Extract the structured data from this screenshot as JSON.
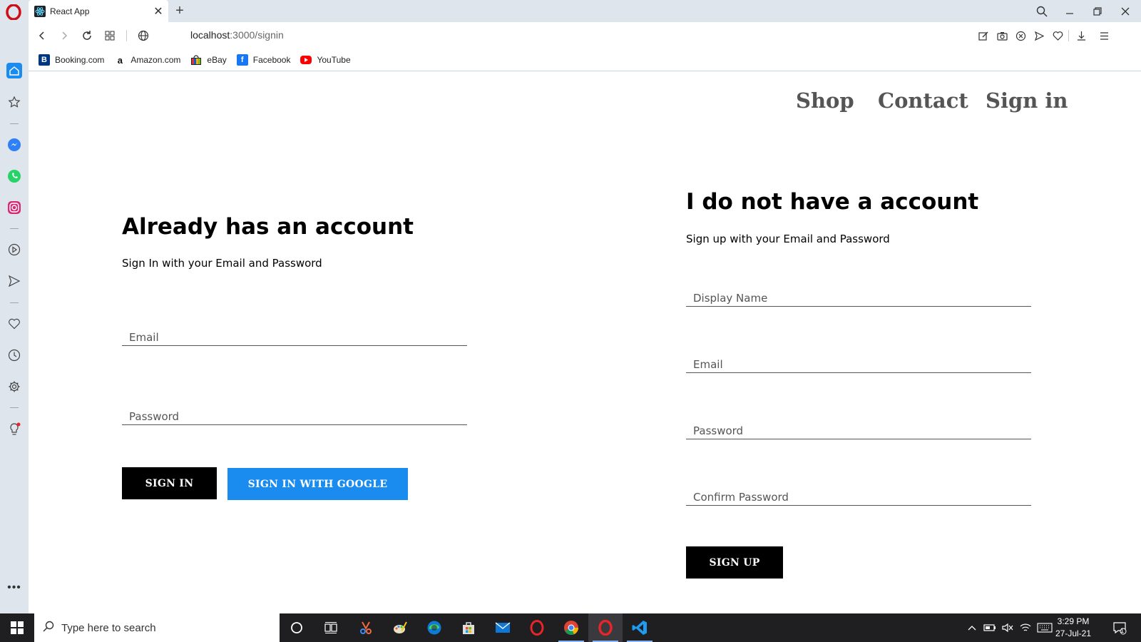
{
  "browser": {
    "tab_title": "React App",
    "url_host": "localhost",
    "url_path": ":3000/signin",
    "bookmarks": [
      {
        "label": "Booking.com",
        "icon": "booking-icon",
        "color": "#003580"
      },
      {
        "label": "Amazon.com",
        "icon": "amazon-icon",
        "color": "#ffffff"
      },
      {
        "label": "eBay",
        "icon": "ebay-icon",
        "color": "#e53238"
      },
      {
        "label": "Facebook",
        "icon": "facebook-icon",
        "color": "#1877f2"
      },
      {
        "label": "YouTube",
        "icon": "youtube-icon",
        "color": "#ff0000"
      }
    ],
    "accent_color": "#cc0f16"
  },
  "nav": {
    "shop": "Shop",
    "contact": "Contact",
    "signin": "Sign in"
  },
  "signin": {
    "title": "Already has an account",
    "subtitle": "Sign In with your Email and Password",
    "email_placeholder": "Email",
    "password_placeholder": "Password",
    "signin_button": "SIGN IN",
    "google_button": "SIGN IN WITH GOOGLE",
    "google_color": "#1a8cf0"
  },
  "signup": {
    "title": "I do not have a account",
    "subtitle": "Sign up with your Email and Password",
    "display_name_placeholder": "Display Name",
    "email_placeholder": "Email",
    "password_placeholder": "Password",
    "confirm_password_placeholder": "Confirm Password",
    "signup_button": "SIGN UP"
  },
  "taskbar": {
    "search_placeholder": "Type here to search",
    "time": "3:29 PM",
    "date": "27-Jul-21",
    "notification_count": "1"
  }
}
